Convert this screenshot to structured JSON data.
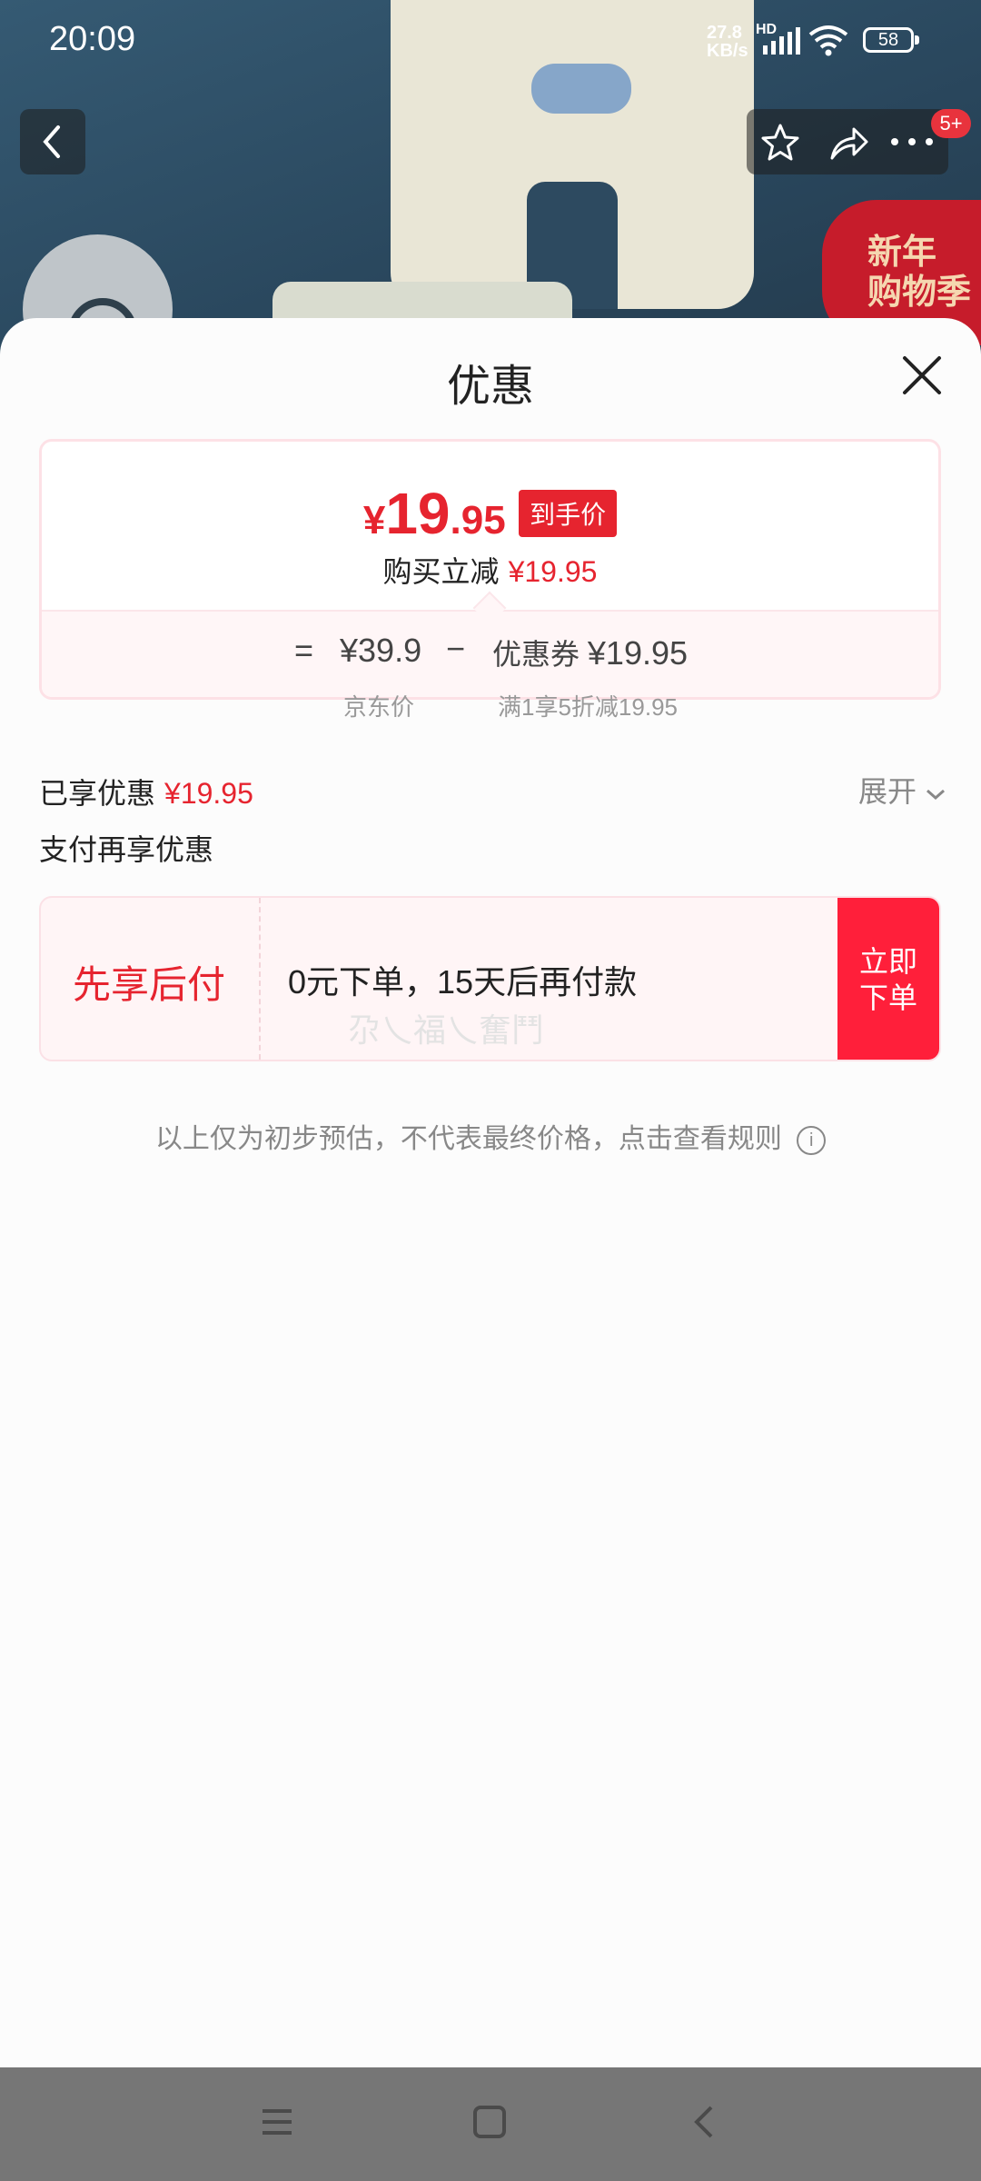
{
  "status": {
    "time": "20:09",
    "net_speed_top": "27.8",
    "net_speed_unit": "KB/s",
    "hd": "HD",
    "battery": "58"
  },
  "page_bg": {
    "promo_badge_line1": "新年",
    "promo_badge_line2": "购物季",
    "notification_count": "5+"
  },
  "sheet": {
    "title": "优惠",
    "final_price": {
      "currency": "¥",
      "integer": "19",
      "decimal": ".95",
      "tag": "到手价"
    },
    "reduce": {
      "label": "购买立减",
      "amount": "¥19.95"
    },
    "calc": {
      "equals": "=",
      "jd_price": "¥39.9",
      "jd_label": "京东价",
      "minus": "−",
      "coupon_label": "优惠券",
      "coupon_value": "¥19.95",
      "coupon_desc": "满1享5折减19.95"
    },
    "enjoyed": {
      "label": "已享优惠",
      "amount": "¥19.95"
    },
    "expand": "展开",
    "pay_more": "支付再享优惠",
    "bnpl": {
      "title": "先享后付",
      "desc": "0元下单，15天后再付款",
      "button_line1": "立即",
      "button_line2": "下单",
      "watermark": "尕乀福乀奮鬥"
    },
    "disclaimer": "以上仅为初步预估，不代表最终价格，点击查看规则"
  },
  "colors": {
    "accent_red": "#e6242f",
    "button_red": "#ff1f3a"
  }
}
